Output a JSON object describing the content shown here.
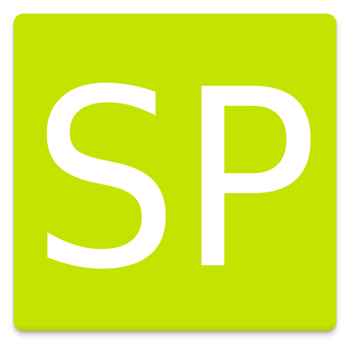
{
  "app_icon": {
    "text": "SP",
    "background_color": "#c4e300",
    "text_color": "#ffffff"
  }
}
